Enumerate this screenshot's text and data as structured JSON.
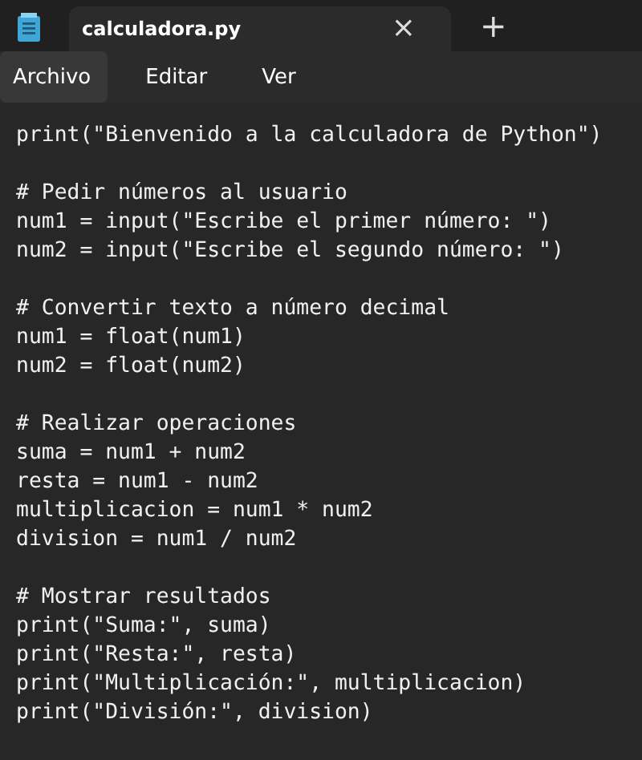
{
  "tabs": [
    {
      "title": "calculadora.py",
      "selected": true,
      "close": "×"
    }
  ],
  "new_tab": "+",
  "menu": [
    {
      "label": "Archivo",
      "selected": true
    },
    {
      "label": "Editar",
      "selected": false
    },
    {
      "label": "Ver",
      "selected": false
    }
  ],
  "editor": {
    "blocks": [
      [
        "print(\"Bienvenido a la calculadora de Python\")"
      ],
      [
        "# Pedir números al usuario",
        "num1 = input(\"Escribe el primer número: \")",
        "num2 = input(\"Escribe el segundo número: \")"
      ],
      [
        "# Convertir texto a número decimal",
        "num1 = float(num1)",
        "num2 = float(num2)"
      ],
      [
        "# Realizar operaciones",
        "suma = num1 + num2",
        "resta = num1 - num2",
        "multiplicacion = num1 * num2",
        "division = num1 / num2"
      ],
      [
        "# Mostrar resultados",
        "print(\"Suma:\", suma)",
        "print(\"Resta:\", resta)",
        "print(\"Multiplicación:\", multiplicacion)",
        "print(\"División:\", division)"
      ]
    ]
  }
}
